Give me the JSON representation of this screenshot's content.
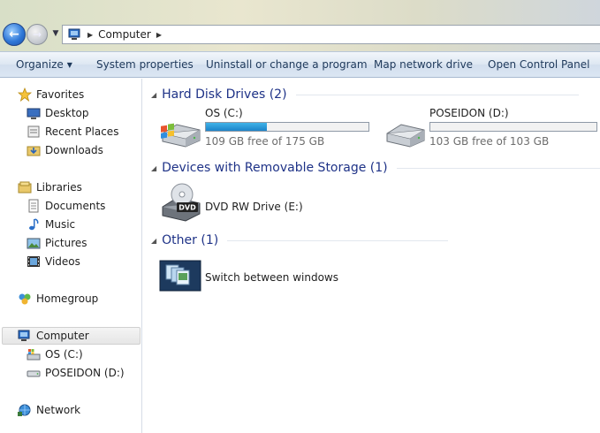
{
  "address": {
    "crumbs": [
      "Computer"
    ]
  },
  "toolbar": {
    "organize": "Organize",
    "system_properties": "System properties",
    "uninstall": "Uninstall or change a program",
    "map_drive": "Map network drive",
    "control_panel": "Open Control Panel"
  },
  "nav": {
    "favorites": "Favorites",
    "desktop": "Desktop",
    "recent_places": "Recent Places",
    "downloads": "Downloads",
    "libraries": "Libraries",
    "documents": "Documents",
    "music": "Music",
    "pictures": "Pictures",
    "videos": "Videos",
    "homegroup": "Homegroup",
    "computer": "Computer",
    "os_c": "OS (C:)",
    "poseidon_d": "POSEIDON (D:)",
    "network": "Network"
  },
  "groups": {
    "hdd": {
      "title": "Hard Disk Drives (2)"
    },
    "removable": {
      "title": "Devices with Removable Storage (1)"
    },
    "other": {
      "title": "Other (1)"
    }
  },
  "drives": [
    {
      "name": "OS (C:)",
      "free_text": "109 GB free of 175 GB",
      "used_fraction": 0.377
    },
    {
      "name": "POSEIDON (D:)",
      "free_text": "103 GB free of 103 GB",
      "used_fraction": 0.0
    }
  ],
  "removable": {
    "name": "DVD RW Drive (E:)"
  },
  "other": {
    "name": "Switch between windows"
  },
  "colors": {
    "accent": "#1e3287",
    "bar_fill": "#2a9ad8"
  }
}
